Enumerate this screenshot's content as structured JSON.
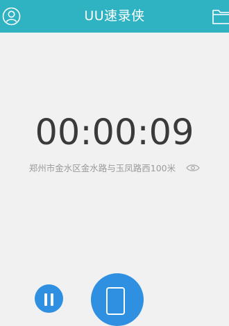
{
  "header": {
    "title": "UU速录侠",
    "left_icon": "user-icon",
    "right_icon": "folder-icon",
    "background_color": "#2fb3c2"
  },
  "recorder": {
    "elapsed_time": "00:00:09",
    "location": "郑州市金水区金水路与玉凤路西100米",
    "visibility_icon": "eye-icon"
  },
  "controls": {
    "pause_icon": "pause-icon",
    "stop_icon": "stop-icon",
    "button_color": "#2f8fe0"
  }
}
